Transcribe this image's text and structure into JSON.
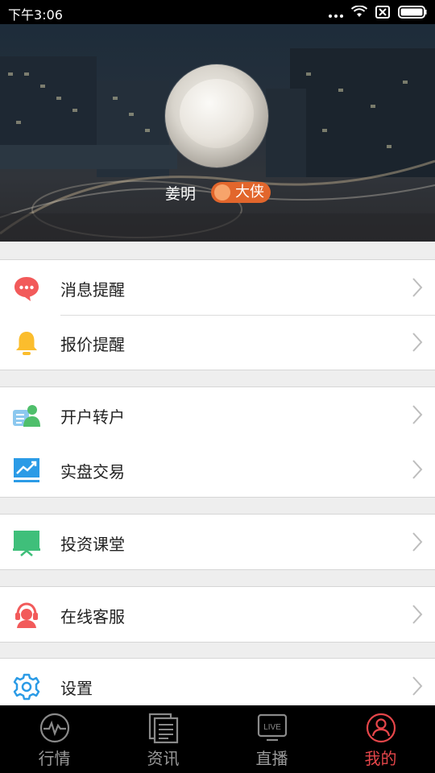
{
  "status_bar": {
    "time": "下午3:06"
  },
  "profile": {
    "name": "姜明",
    "badge": "大侠"
  },
  "menu": {
    "groups": [
      {
        "items": [
          {
            "label": "消息提醒",
            "icon": "message-icon",
            "color": "#f25a5a"
          },
          {
            "label": "报价提醒",
            "icon": "bell-icon",
            "color": "#fbbd2d"
          }
        ]
      },
      {
        "items": [
          {
            "label": "开户转户",
            "icon": "account-icon",
            "color": "#4fbf6b"
          },
          {
            "label": "实盘交易",
            "icon": "trend-chart-icon",
            "color": "#2b9be6"
          }
        ]
      },
      {
        "items": [
          {
            "label": "投资课堂",
            "icon": "classroom-icon",
            "color": "#3fbf7a"
          }
        ]
      },
      {
        "items": [
          {
            "label": "在线客服",
            "icon": "headset-icon",
            "color": "#f25a5a"
          }
        ]
      },
      {
        "items": [
          {
            "label": "设置",
            "icon": "gear-icon",
            "color": "#2b9be6"
          }
        ]
      }
    ]
  },
  "tabbar": {
    "tabs": [
      {
        "label": "行情",
        "icon": "pulse-icon"
      },
      {
        "label": "资讯",
        "icon": "news-icon"
      },
      {
        "label": "直播",
        "icon": "live-icon"
      },
      {
        "label": "我的",
        "icon": "user-icon",
        "active": true
      }
    ]
  },
  "colors": {
    "accent": "#e6464a",
    "tabbar_bg": "#000000"
  }
}
